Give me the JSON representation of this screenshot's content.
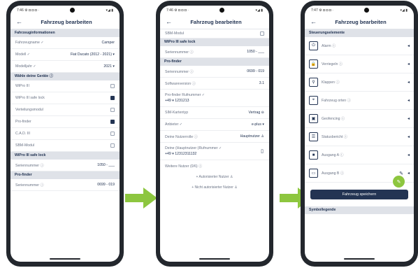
{
  "phone1": {
    "status_left": "7:46 ⚙ ◘ ◘ ◘ ·",
    "status_right": "▾◢ ▮",
    "title": "Fahrzeug bearbeiten",
    "back_icon": "←",
    "section1": "Fahrzeuginformationen",
    "rows": [
      {
        "label": "Fahrzeugname ✓",
        "value": "Camper"
      },
      {
        "label": "Modell ✓",
        "value": "Fiat Ducato (2012 - 2021) ▾"
      },
      {
        "label": "Modelljahr ✓",
        "value": "2021 ▾"
      }
    ],
    "section2": "Wähle deine Geräte ⓘ",
    "devices": [
      {
        "label": "WiPro III",
        "checked": false
      },
      {
        "label": "WiPro III safe lock",
        "checked": true
      },
      {
        "label": "Verteilungsmodul",
        "checked": false
      },
      {
        "label": "Pro-finder",
        "checked": true
      },
      {
        "label": "C.A.D. III",
        "checked": false
      },
      {
        "label": "SBM-Modul",
        "checked": false
      }
    ],
    "section3": "WiPro III safe lock",
    "serial_label": "Seriennummer ⓘ",
    "serial_value": "1050 - ___",
    "section4": "Pro-finder",
    "serial2_value": "0699 - 019"
  },
  "phone2": {
    "status_left": "7:46 ⚙ ◘ ◘ ◘ ·",
    "status_right": "▾◢ ▮",
    "title": "Fahrzeug bearbeiten",
    "back_icon": "←",
    "top_row": "SBM-Modul",
    "section1": "WiPro III safe lock",
    "serial_label": "Seriennummer ⓘ",
    "serial_value": "1050 - ___",
    "section2": "Pro-finder",
    "rows": [
      {
        "label": "Seriennummer ⓘ",
        "value": "0699 - 019"
      },
      {
        "label": "Softwareversion ⓘ",
        "value": "3.1"
      }
    ],
    "phone_label": "Pro-finder Rufnummer ✓",
    "phone_value": "+49 ▾ 1231213",
    "sim_label": "SIM-Kartentyp",
    "sim_value": "Vertrag ⊖",
    "provider_label": "Anbieter ✓",
    "provider_value": "e-plus ▾",
    "role_label": "Deine Nutzerrolle ⓘ",
    "role_value": "Hauptnutzer ♙",
    "main_label": "Deine (Hauptnutzer-)Rufnummer ✓",
    "main_value": "+49 ▾ 12312311132",
    "main_icon": "▯",
    "more_label": "Weitere Nutzer (0/6) ⓘ",
    "auth_btn": "+ Autorisierter Nutzer ♙",
    "nonauth_btn": "+ Nicht autorisierter Nutzer ♙"
  },
  "phone3": {
    "status_left": "7:47 ⚙ ◘ ◘ ◘ ·",
    "status_right": "▾◢ ▮",
    "title": "Fahrzeug bearbeiten",
    "back_icon": "←",
    "section1": "Steuerungselemente",
    "controls": [
      {
        "label": "Alarm ⓘ",
        "icon": "⏻"
      },
      {
        "label": "Verriegeln ⓘ",
        "icon": "🔒"
      },
      {
        "label": "Klappen ⓘ",
        "icon": "⚲"
      },
      {
        "label": "Fahrzeug orten ⓘ",
        "icon": "⌖"
      },
      {
        "label": "Geofencing ⓘ",
        "icon": "▣"
      },
      {
        "label": "Statusbericht ⓘ",
        "icon": "☰"
      },
      {
        "label": "Ausgang A ⓘ",
        "icon": "■"
      },
      {
        "label": "Ausgang B ⓘ",
        "icon": "▭"
      }
    ],
    "edit_icon": "✎",
    "save_label": "Fahrzeug speichern",
    "legend_label": "Symbollegende"
  }
}
